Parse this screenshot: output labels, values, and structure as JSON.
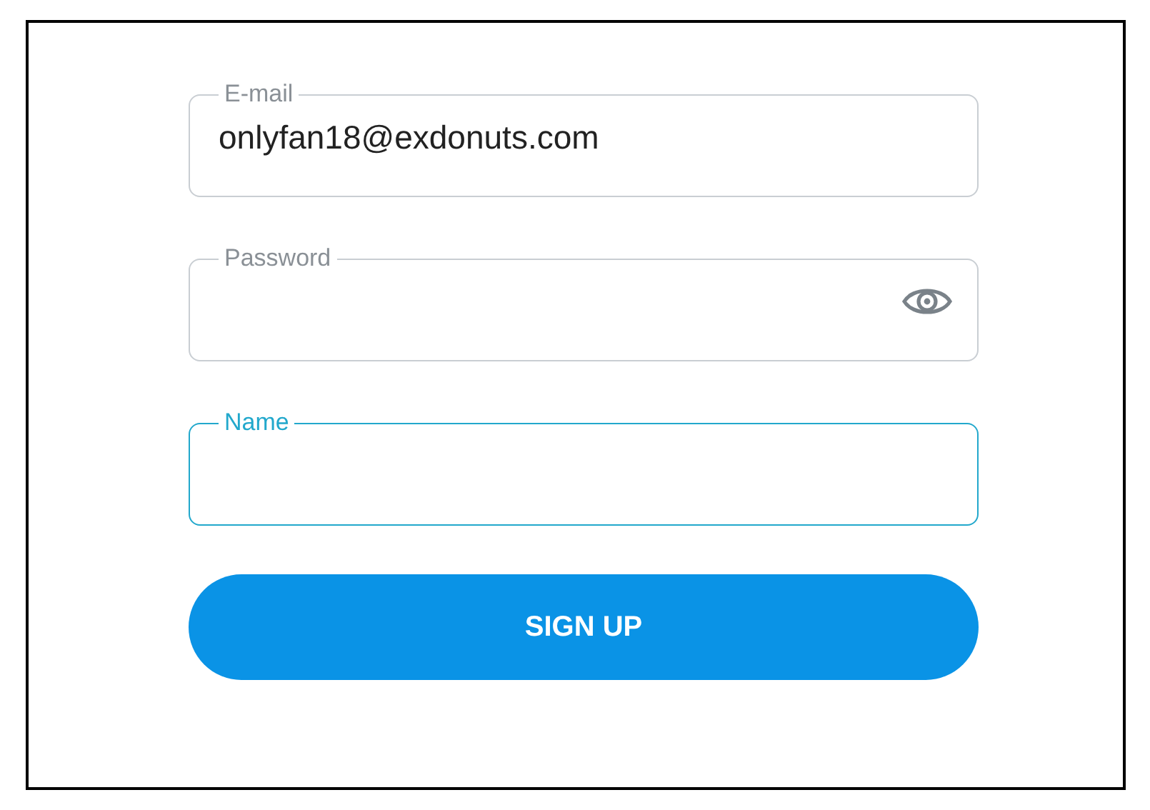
{
  "fields": [
    {
      "kind": "email",
      "label": "E-mail",
      "value": "onlyfan18@exdonuts.com",
      "focused": false
    },
    {
      "kind": "password",
      "label": "Password",
      "focused": false
    },
    {
      "kind": "text",
      "label": "Name",
      "focused": true
    }
  ],
  "submit_button": {
    "label": "SIGN UP"
  }
}
